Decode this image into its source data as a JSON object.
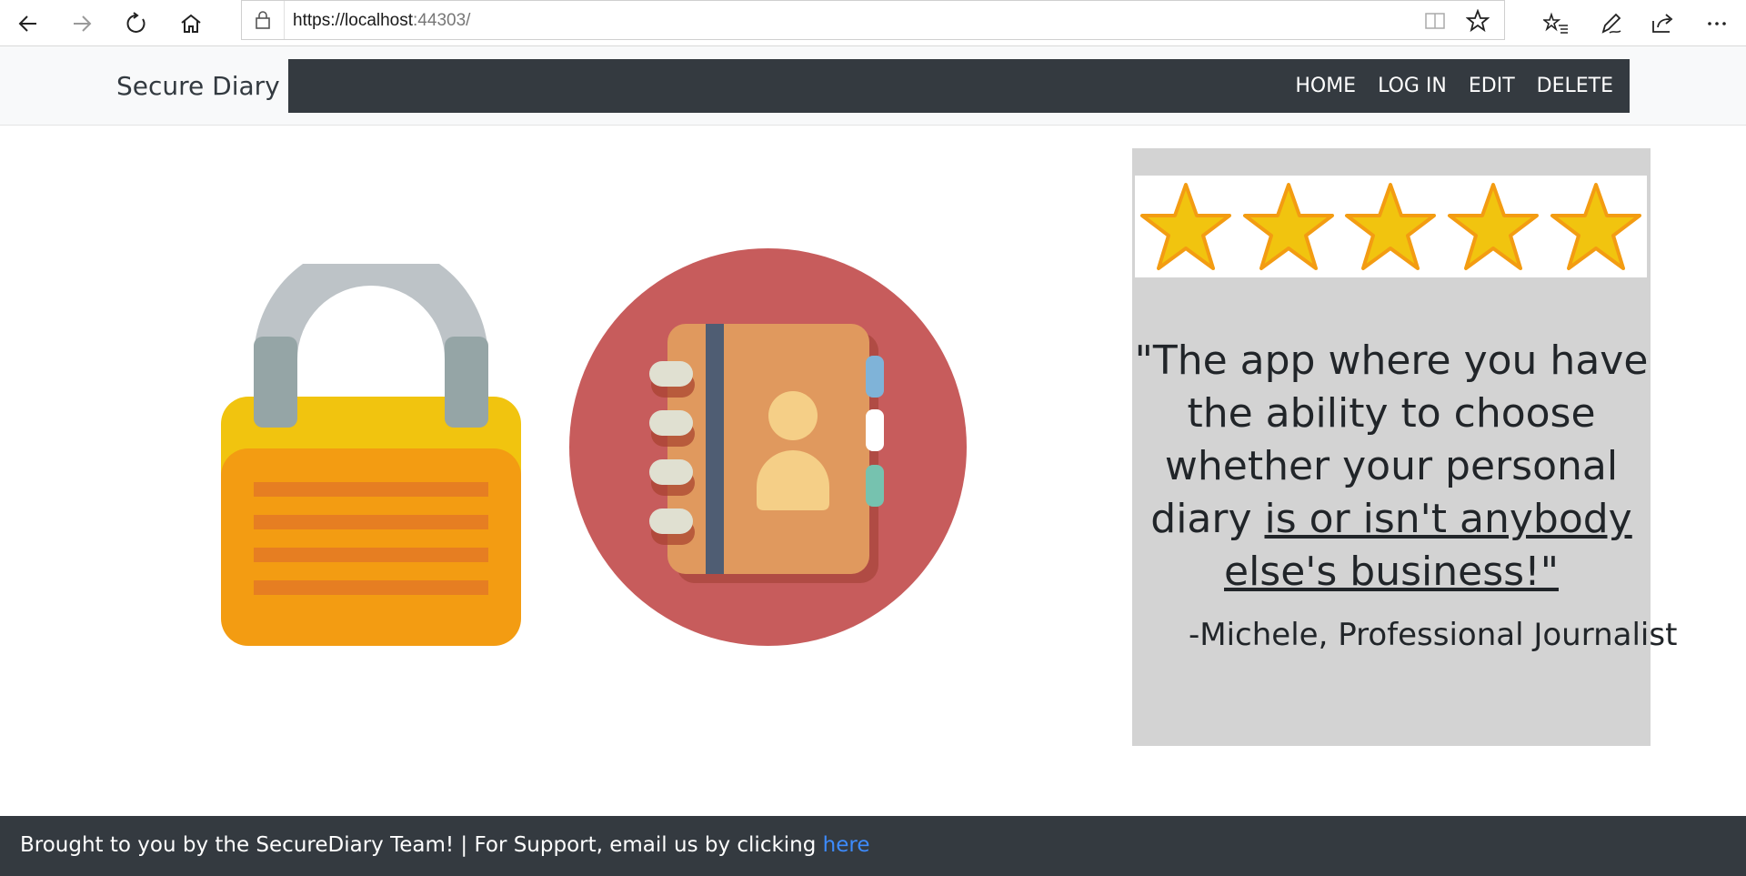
{
  "browser": {
    "url_host": "https://localhost",
    "url_port_path": ":44303/"
  },
  "app": {
    "brand": "Secure Diary",
    "nav": [
      "HOME",
      "LOG IN",
      "EDIT",
      "DELETE"
    ]
  },
  "testimonial": {
    "rating": 5,
    "rating_max": 5,
    "quote_plain": "\"The app where you have the ability to choose whether your personal diary ",
    "quote_underlined": "is or isn't anybody else's business!\"",
    "author": "-Michele, Professional Journalist"
  },
  "footer": {
    "text": "Brought to you by the SecureDiary Team! | For Support, email us by clicking ",
    "link_text": "here"
  },
  "icons": {
    "back": "arrow-left-icon",
    "forward": "arrow-right-icon",
    "refresh": "refresh-icon",
    "home": "home-icon",
    "lock": "lock-icon",
    "reading_view": "book-icon",
    "favorite": "star-outline-icon",
    "favorites_hub": "favorites-list-icon",
    "notes": "pen-icon",
    "share": "share-icon",
    "more": "more-icon",
    "padlock_art": "padlock-icon",
    "address_book_art": "address-book-icon",
    "rating_star": "star-icon"
  },
  "colors": {
    "nav_dark": "#343a40",
    "star_fill": "#f1c40f",
    "star_stroke": "#f39c12",
    "testimonial_bg": "#d3d3d3",
    "link": "#3d8bfd"
  }
}
